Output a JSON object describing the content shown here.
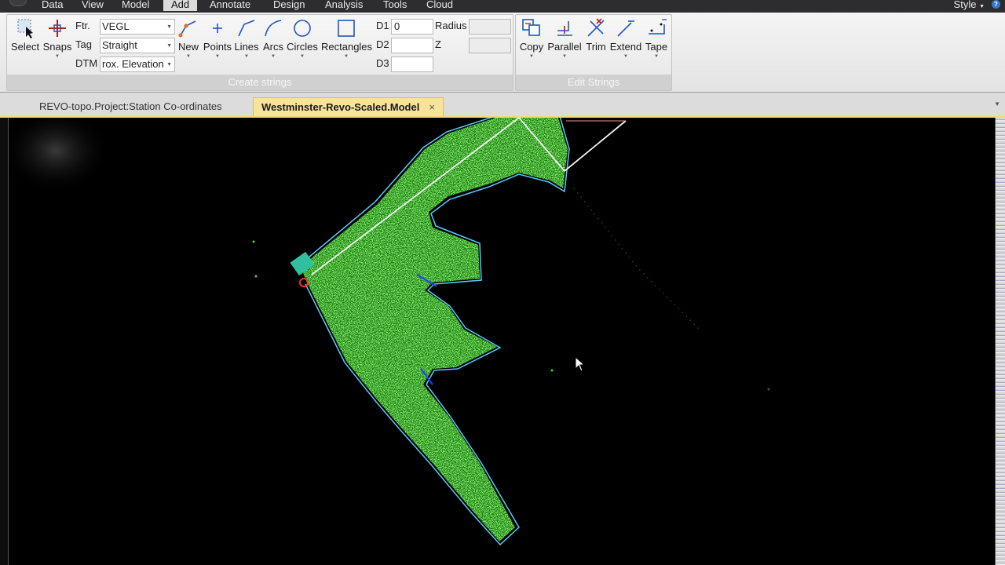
{
  "menubar": {
    "items": [
      "Data",
      "View",
      "Model",
      "Add",
      "Annotate",
      "Design",
      "Analysis",
      "Tools",
      "Cloud"
    ],
    "active": "Add",
    "style_label": "Style",
    "help_glyph": "?"
  },
  "ribbon": {
    "create_strings": {
      "label": "Create strings",
      "select_label": "Select",
      "snaps_label": "Snaps",
      "ftr_label": "Ftr.",
      "ftr_value": "VEGL",
      "tag_label": "Tag",
      "tag_value": "Straight",
      "dtm_label": "DTM",
      "dtm_value": "rox. Elevation",
      "tools": [
        "New",
        "Points",
        "Lines",
        "Arcs",
        "Circles",
        "Rectangles"
      ],
      "d1_label": "D1",
      "d1_value": "0",
      "d2_label": "D2",
      "d2_value": "",
      "d3_label": "D3",
      "d3_value": "",
      "radius_label": "Radius",
      "radius_value": "",
      "z_label": "Z",
      "z_value": ""
    },
    "edit_strings": {
      "label": "Edit Strings",
      "tools": [
        "Copy",
        "Parallel",
        "Trim",
        "Extend",
        "Tape"
      ]
    }
  },
  "tabs": [
    {
      "label": "REVO-topo.Project:Station Co-ordinates",
      "active": false
    },
    {
      "label": "Westminster-Revo-Scaled.Model",
      "active": true,
      "close": "×"
    }
  ],
  "colors": {
    "point_cloud": "#3cdc28",
    "boundary_string": "#58c8ff",
    "reference_line": "#ffffff",
    "active_tab": "#f8e39a"
  }
}
